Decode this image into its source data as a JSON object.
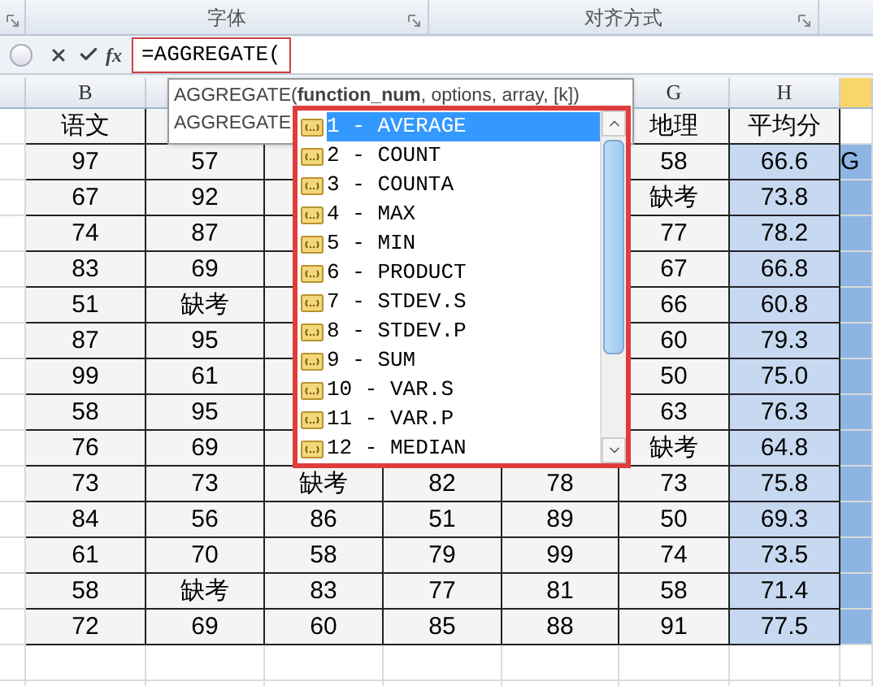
{
  "ribbon": {
    "groups": [
      "字体",
      "对齐方式"
    ]
  },
  "formula_bar": {
    "fx": "fx",
    "value": "=AGGREGATE("
  },
  "tooltip": {
    "lines": [
      "AGGREGATE(**function_num**, options, array, [k])",
      "AGGREGATE"
    ]
  },
  "dropdown": {
    "items": [
      {
        "label": "1 - AVERAGE",
        "selected": true
      },
      {
        "label": "2 - COUNT",
        "selected": false
      },
      {
        "label": "3 - COUNTA",
        "selected": false
      },
      {
        "label": "4 - MAX",
        "selected": false
      },
      {
        "label": "5 - MIN",
        "selected": false
      },
      {
        "label": "6 - PRODUCT",
        "selected": false
      },
      {
        "label": "7 - STDEV.S",
        "selected": false
      },
      {
        "label": "8 - STDEV.P",
        "selected": false
      },
      {
        "label": "9 - SUM",
        "selected": false
      },
      {
        "label": "10 - VAR.S",
        "selected": false
      },
      {
        "label": "11 - VAR.P",
        "selected": false
      },
      {
        "label": "12 - MEDIAN",
        "selected": false
      }
    ]
  },
  "sheet": {
    "columns": [
      null,
      "B",
      null,
      null,
      null,
      null,
      "G",
      "H",
      null
    ],
    "rows": [
      {
        "cells": [
          null,
          "语文",
          null,
          null,
          null,
          null,
          "地理",
          "平均分",
          null
        ]
      },
      {
        "cells": [
          null,
          "97",
          "57",
          null,
          null,
          null,
          "58",
          "66.6",
          "G"
        ]
      },
      {
        "cells": [
          null,
          "67",
          "92",
          null,
          null,
          null,
          "缺考",
          "73.8",
          null
        ]
      },
      {
        "cells": [
          null,
          "74",
          "87",
          null,
          null,
          null,
          "77",
          "78.2",
          null
        ]
      },
      {
        "cells": [
          null,
          "83",
          "69",
          null,
          null,
          null,
          "67",
          "66.8",
          null
        ]
      },
      {
        "cells": [
          null,
          "51",
          "缺考",
          null,
          null,
          null,
          "66",
          "60.8",
          null
        ]
      },
      {
        "cells": [
          null,
          "87",
          "95",
          null,
          null,
          null,
          "60",
          "79.3",
          null
        ]
      },
      {
        "cells": [
          null,
          "99",
          "61",
          null,
          null,
          null,
          "50",
          "75.0",
          null
        ]
      },
      {
        "cells": [
          null,
          "58",
          "95",
          null,
          null,
          null,
          "63",
          "76.3",
          null
        ]
      },
      {
        "cells": [
          null,
          "76",
          "69",
          null,
          null,
          null,
          "缺考",
          "64.8",
          null
        ]
      },
      {
        "cells": [
          null,
          "73",
          "73",
          "缺考",
          "82",
          "78",
          "73",
          "75.8",
          null
        ]
      },
      {
        "cells": [
          null,
          "84",
          "56",
          "86",
          "51",
          "89",
          "50",
          "69.3",
          null
        ]
      },
      {
        "cells": [
          null,
          "61",
          "70",
          "58",
          "79",
          "99",
          "74",
          "73.5",
          null
        ]
      },
      {
        "cells": [
          null,
          "58",
          "缺考",
          "83",
          "77",
          "81",
          "58",
          "71.4",
          null
        ]
      },
      {
        "cells": [
          null,
          "72",
          "69",
          "60",
          "85",
          "88",
          "91",
          "77.5",
          null
        ]
      }
    ]
  }
}
